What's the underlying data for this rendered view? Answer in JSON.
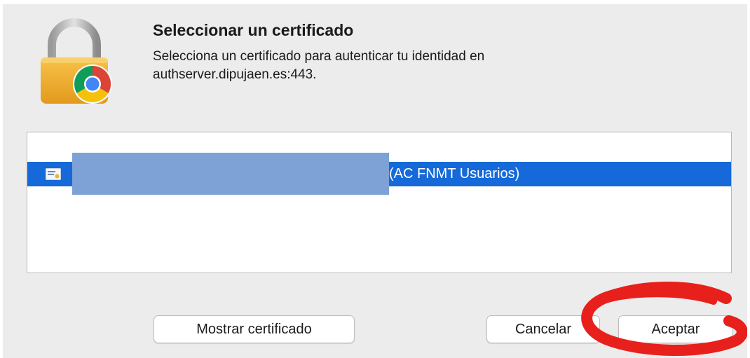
{
  "dialog": {
    "title": "Seleccionar un certificado",
    "message_line1": "Selecciona un certificado para autenticar tu identidad en",
    "message_line2": "authserver.dipujaen.es:443."
  },
  "certificates": [
    {
      "label": "(AC FNMT Usuarios)",
      "selected": true
    }
  ],
  "buttons": {
    "show_certificate": "Mostrar certificado",
    "cancel": "Cancelar",
    "accept": "Aceptar"
  },
  "icons": {
    "header": "lock-with-chrome-icon",
    "certificate": "certificate-icon"
  },
  "colors": {
    "selection": "#1569d8",
    "redaction": "#7ea1d6",
    "annotation": "#e8201c"
  }
}
